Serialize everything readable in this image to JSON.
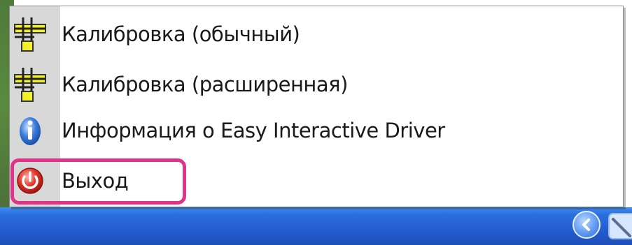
{
  "menu": {
    "items": [
      {
        "label": "Калибровка (обычный)",
        "icon": "crosshair-calibration-icon"
      },
      {
        "label": "Калибровка (расширенная)",
        "icon": "crosshair-calibration-icon"
      },
      {
        "label": "Информация о Easy Interactive Driver",
        "icon": "info-icon"
      },
      {
        "label": "Выход",
        "icon": "exit-icon"
      }
    ]
  },
  "colors": {
    "highlight": "#e0338a",
    "taskbar": "#245dd0",
    "calibration_icon": "#f2ef2e"
  }
}
